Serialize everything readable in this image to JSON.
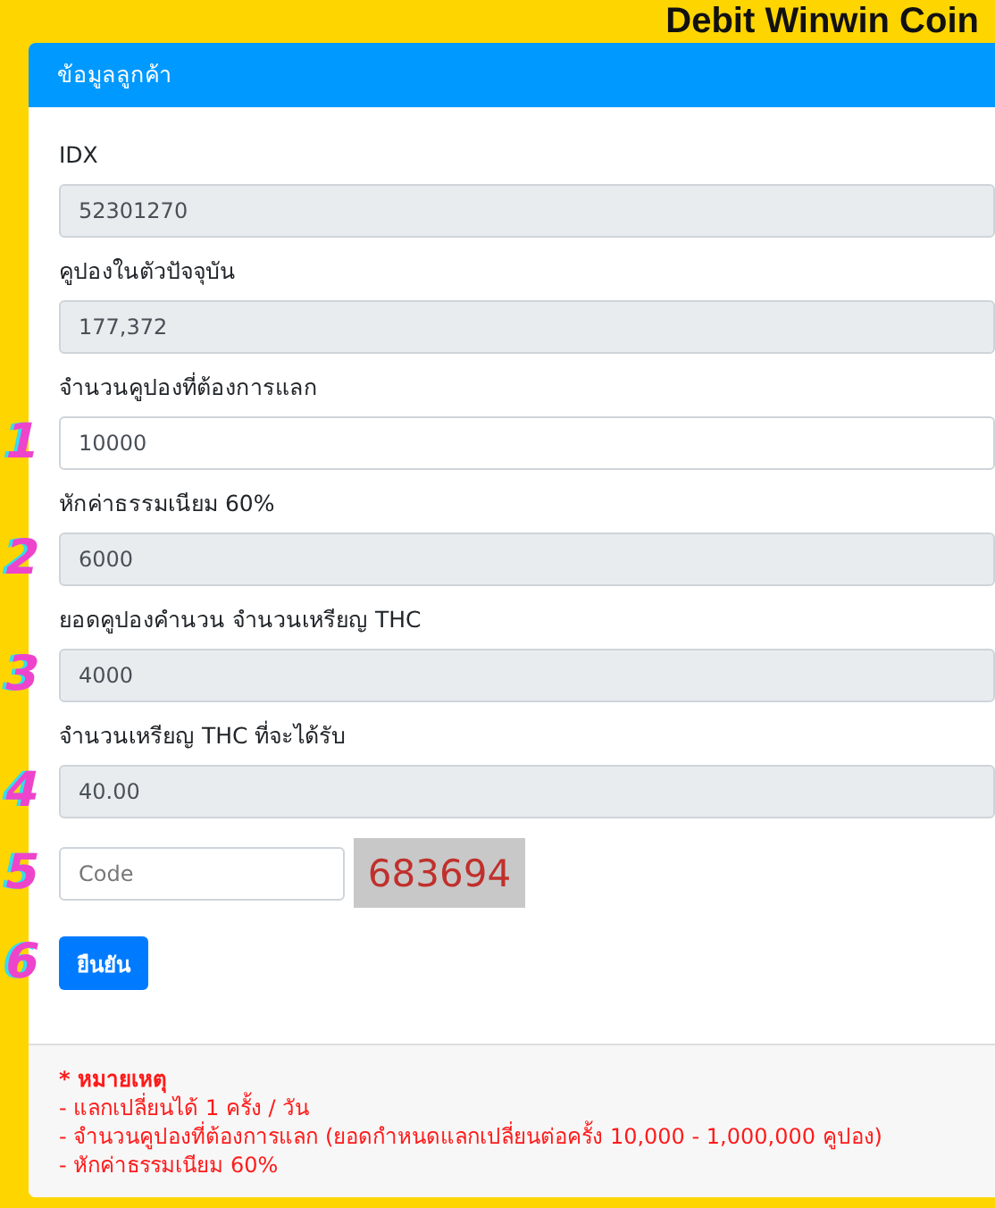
{
  "title": "Debit Winwin Coin",
  "card": {
    "header": "ข้อมูลลูกค้า",
    "fields": [
      {
        "label": "IDX",
        "value": "52301270",
        "readonly": true
      },
      {
        "label": "คูปองในตัวปัจจุบัน",
        "value": "177,372",
        "readonly": true
      },
      {
        "label": "จำนวนคูปองที่ต้องการแลก",
        "value": "10000",
        "readonly": false,
        "marker": "1"
      },
      {
        "label": "หักค่าธรรมเนียม 60%",
        "value": "6000",
        "readonly": true,
        "marker": "2"
      },
      {
        "label": "ยอดคูปองคำนวน จำนวนเหรียญ THC",
        "value": "4000",
        "readonly": true,
        "marker": "3"
      },
      {
        "label": "จำนวนเหรียญ THC ที่จะได้รับ",
        "value": "40.00",
        "readonly": true,
        "marker": "4"
      }
    ],
    "code_field": {
      "placeholder": "Code",
      "marker": "5"
    },
    "captcha": "683694",
    "submit": {
      "label": "ยืนยัน",
      "marker": "6"
    },
    "notes": {
      "title": "* หมายเหตุ",
      "lines": [
        "- แลกเปลี่ยนได้ 1 ครั้ง / วัน",
        "- จำนวนคูปองที่ต้องการแลก (ยอดกำหนดแลกเปลี่ยนต่อครั้ง 10,000 - 1,000,000 คูปอง)",
        "- หักค่าธรรมเนียม 60%"
      ]
    }
  }
}
